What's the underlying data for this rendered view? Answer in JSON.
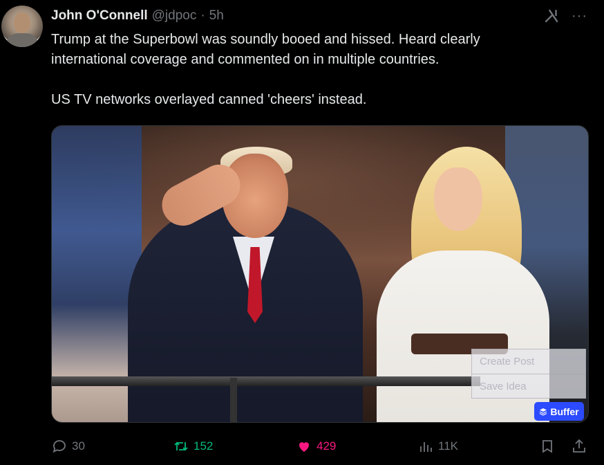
{
  "post": {
    "author_name": "John O'Connell",
    "handle": "@jdpoc",
    "separator": "·",
    "time": "5h",
    "text_p1": "Trump at the Superbowl was soundly booed and hissed. Heard clearly\ninternational coverage and commented on in multiple countries.",
    "text_p2": "US TV networks overlayed canned 'cheers' instead."
  },
  "top_icons": {
    "grok": "grok-icon",
    "more": "···"
  },
  "buffer": {
    "menu_items": [
      "Create Post",
      "Save Idea"
    ],
    "badge_label": "Buffer"
  },
  "actions": {
    "replies": "30",
    "reposts": "152",
    "likes": "429",
    "views": "11K"
  },
  "colors": {
    "background": "#000000",
    "text": "#e7e9ea",
    "muted": "#71767b",
    "repost_active": "#00ba7c",
    "like_active": "#f91880",
    "buffer_blue": "#2c4bff"
  }
}
